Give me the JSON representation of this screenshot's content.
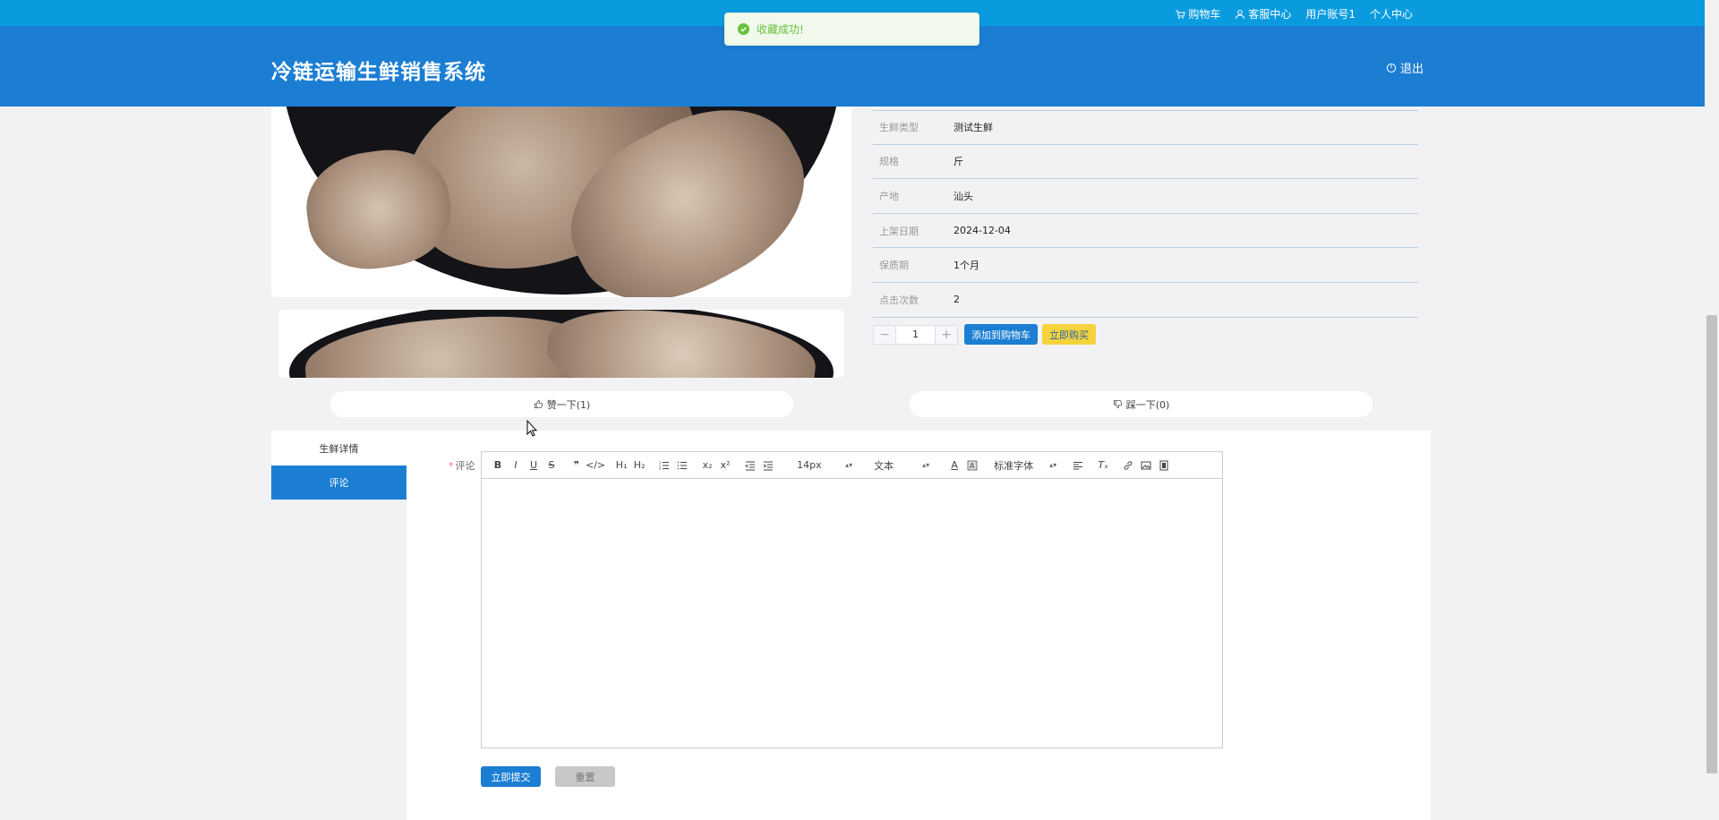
{
  "toast": {
    "message": "收藏成功!"
  },
  "topbar": {
    "links": [
      "购物车",
      "客服中心",
      "用户账号1",
      "个人中心"
    ]
  },
  "header": {
    "title": "冷链运输生鲜销售系统",
    "logout_label": "退出"
  },
  "product": {
    "fields": [
      {
        "label": "生鲜类型",
        "value": "测试生鲜"
      },
      {
        "label": "规格",
        "value": "斤"
      },
      {
        "label": "产地",
        "value": "汕头"
      },
      {
        "label": "上架日期",
        "value": "2024-12-04"
      },
      {
        "label": "保质期",
        "value": "1个月"
      },
      {
        "label": "点击次数",
        "value": "2"
      }
    ],
    "quantity": "1",
    "add_to_cart_label": "添加到购物车",
    "buy_now_label": "立即购买"
  },
  "votes": {
    "like_label": "赞一下(1)",
    "dislike_label": "踩一下(0)"
  },
  "tabs": [
    "生鲜详情",
    "评论"
  ],
  "active_tab": "评论",
  "comment_form": {
    "label": "评论",
    "toolbar": {
      "font_size": "14px",
      "heading": "文本",
      "font_family": "标准字体"
    },
    "submit_label": "立即提交",
    "reset_label": "重置"
  },
  "colors": {
    "primary": "#1b7ed3",
    "topbar": "#0a9bdf",
    "buy": "#f5d33c",
    "success": "#67c23a"
  }
}
